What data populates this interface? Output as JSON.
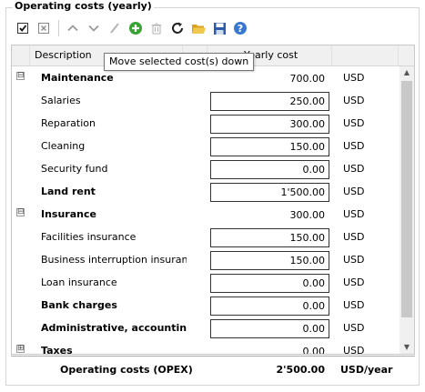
{
  "group_title": "Operating costs (yearly)",
  "toolbar": {
    "buttons": [
      {
        "name": "select-all-icon"
      },
      {
        "name": "deselect-icon"
      },
      {
        "name": "move-up-icon"
      },
      {
        "name": "move-down-icon"
      },
      {
        "name": "edit-icon"
      },
      {
        "name": "add-icon",
        "color": "#3aa335"
      },
      {
        "name": "delete-icon"
      },
      {
        "name": "refresh-icon"
      },
      {
        "name": "open-folder-icon",
        "color": "#e8b830"
      },
      {
        "name": "save-icon",
        "color": "#2a5caa"
      },
      {
        "name": "help-icon",
        "color": "#3a78d0"
      }
    ]
  },
  "tooltip": "Move selected cost(s) down",
  "columns": {
    "description": "Description",
    "yearly_cost": "Yearly cost"
  },
  "rows": [
    {
      "expander": "⊟",
      "label": "Maintenance",
      "bold": true,
      "value": "700.00",
      "boxed": false,
      "currency": "USD"
    },
    {
      "expander": "",
      "label": "Salaries",
      "bold": false,
      "value": "250.00",
      "boxed": true,
      "currency": "USD"
    },
    {
      "expander": "",
      "label": "Reparation",
      "bold": false,
      "value": "300.00",
      "boxed": true,
      "currency": "USD"
    },
    {
      "expander": "",
      "label": "Cleaning",
      "bold": false,
      "value": "150.00",
      "boxed": true,
      "currency": "USD"
    },
    {
      "expander": "",
      "label": "Security fund",
      "bold": false,
      "value": "0.00",
      "boxed": true,
      "currency": "USD"
    },
    {
      "expander": "",
      "label": "Land rent",
      "bold": true,
      "value": "1'500.00",
      "boxed": true,
      "currency": "USD"
    },
    {
      "expander": "⊟",
      "label": "Insurance",
      "bold": true,
      "value": "300.00",
      "boxed": false,
      "currency": "USD"
    },
    {
      "expander": "",
      "label": "Facilities insurance",
      "bold": false,
      "value": "150.00",
      "boxed": true,
      "currency": "USD"
    },
    {
      "expander": "",
      "label": "Business interruption insurance",
      "bold": false,
      "value": "150.00",
      "boxed": true,
      "currency": "USD"
    },
    {
      "expander": "",
      "label": "Loan insurance",
      "bold": false,
      "value": "0.00",
      "boxed": true,
      "currency": "USD"
    },
    {
      "expander": "",
      "label": "Bank charges",
      "bold": true,
      "value": "0.00",
      "boxed": true,
      "currency": "USD"
    },
    {
      "expander": "",
      "label": "Administrative, accounting",
      "bold": true,
      "value": "0.00",
      "boxed": true,
      "currency": "USD"
    },
    {
      "expander": "⊞",
      "label": "Taxes",
      "bold": true,
      "value": "0.00",
      "boxed": false,
      "currency": "USD"
    }
  ],
  "footer": {
    "label": "Operating costs (OPEX)",
    "value": "2'500.00",
    "unit": "USD/year"
  }
}
